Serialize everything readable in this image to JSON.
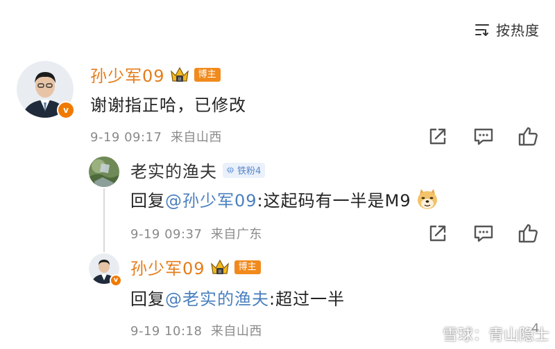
{
  "sort": {
    "label": "按热度",
    "icon": "sort-lines-icon"
  },
  "comment": {
    "author": "孙少军09",
    "badge": "博主",
    "crown_level": "II",
    "verified_mark": "v",
    "text": "谢谢指正哈，已修改",
    "time": "9-19 09:17",
    "location": "来自山西"
  },
  "replies": [
    {
      "author": "老实的渔夫",
      "fan_badge": "铁粉4",
      "reply_prefix": "回复",
      "mention": "@孙少军09",
      "text": ":这起码有一半是M9",
      "emoji": "doge-emoji",
      "time": "9-19 09:37",
      "location": "来自广东"
    },
    {
      "author": "孙少军09",
      "badge": "博主",
      "crown_level": "II",
      "verified_mark": "v",
      "reply_prefix": "回复",
      "mention": "@老实的渔夫",
      "text": ":超过一半",
      "time": "9-19 10:18",
      "location": "来自山西",
      "like_count": "4"
    }
  ],
  "watermark": {
    "text": "雪球：青山隐士",
    "icon": "xueqiu-logo-icon"
  },
  "colors": {
    "name_accent": "#e47c1a",
    "mention": "#4a7fbf",
    "badge_bg": "#f18a1c",
    "fan_badge_bg": "#eaf1fb",
    "meta_gray": "#8a8a8a"
  }
}
